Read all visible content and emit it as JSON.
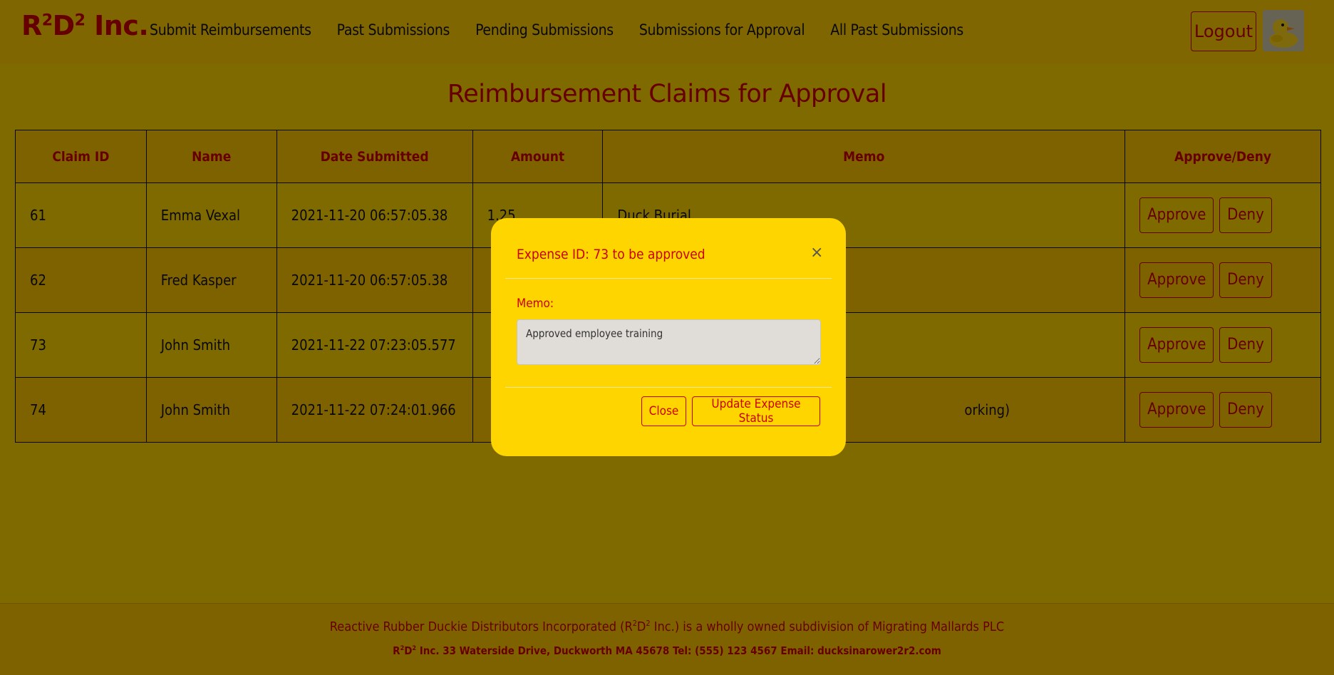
{
  "navbar": {
    "brand_r": "R",
    "brand_sup1": "2",
    "brand_d": "D",
    "brand_sup2": "2",
    "brand_suffix": " Inc.",
    "links": [
      "Submit Reimbursements",
      "Past Submissions",
      "Pending Submissions",
      "Submissions for Approval",
      "All Past Submissions"
    ],
    "logout_label": "Logout",
    "avatar_icon": "rubber-duck-icon"
  },
  "page": {
    "title": "Reimbursement Claims for Approval"
  },
  "table": {
    "headers": [
      "Claim ID",
      "Name",
      "Date Submitted",
      "Amount",
      "Memo",
      "Approve/Deny"
    ],
    "approve_label": "Approve",
    "deny_label": "Deny",
    "rows": [
      {
        "id": "61",
        "name": "Emma Vexal",
        "date": "2021-11-20 06:57:05.38",
        "amount": "1.25",
        "memo": "Duck Burial"
      },
      {
        "id": "62",
        "name": "Fred Kasper",
        "date": "2021-11-20 06:57:05.38",
        "amount": "",
        "memo": ""
      },
      {
        "id": "73",
        "name": "John Smith",
        "date": "2021-11-22 07:23:05.577",
        "amount": "",
        "memo": ""
      },
      {
        "id": "74",
        "name": "John Smith",
        "date": "2021-11-22 07:24:01.966",
        "amount": "",
        "memo": "orking)"
      }
    ]
  },
  "modal": {
    "title": "Expense ID: 73 to be approved",
    "close_x": "×",
    "memo_label": "Memo:",
    "memo_value": "Approved employee training",
    "close_label": "Close",
    "update_label": "Update Expense Status"
  },
  "footer": {
    "line1_pre": "Reactive Rubber Duckie Distributors Incorporated (R",
    "line1_sup1": "2",
    "line1_mid": "D",
    "line1_sup2": "2",
    "line1_post": " Inc.) is a wholly owned subdivision of Migrating Mallards PLC",
    "line2_r": "R",
    "line2_sup1": "2",
    "line2_d": "D",
    "line2_sup2": "2",
    "line2_post": " Inc. 33 Waterside Drive, Duckworth MA 45678 Tel: (555) 123 4567 Email: ducksinarower2r2.com"
  }
}
